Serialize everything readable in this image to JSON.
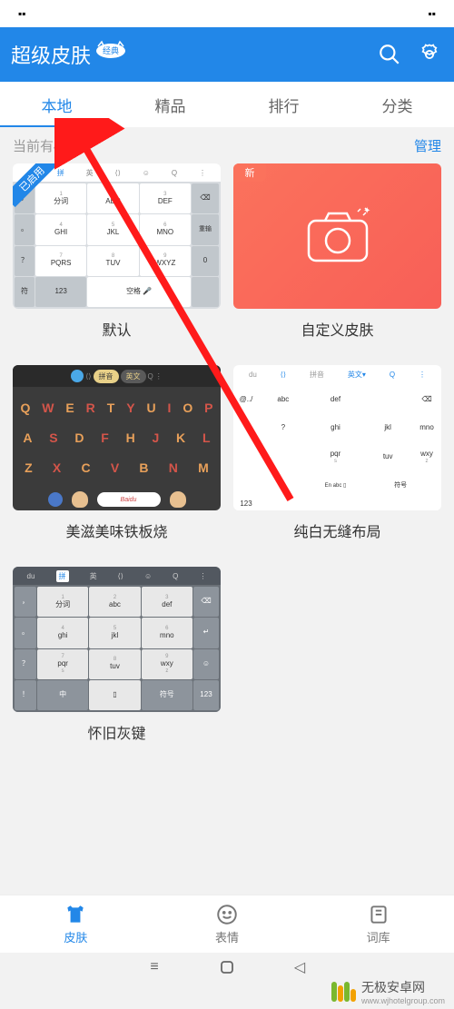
{
  "header": {
    "title": "超级皮肤",
    "badge": "经典"
  },
  "tabs": [
    {
      "label": "本地",
      "active": true
    },
    {
      "label": "精品",
      "active": false
    },
    {
      "label": "排行",
      "active": false
    },
    {
      "label": "分类",
      "active": false
    }
  ],
  "subheader": {
    "count_text": "当前有4套皮",
    "manage": "管理"
  },
  "skins": [
    {
      "name": "默认",
      "badge": "已启用",
      "badge_color": "blue",
      "type": "default-kb"
    },
    {
      "name": "自定义皮肤",
      "badge": "新",
      "badge_color": "red",
      "type": "custom"
    },
    {
      "name": "美滋美味铁板烧",
      "type": "food-kb"
    },
    {
      "name": "纯白无缝布局",
      "type": "white-kb"
    },
    {
      "name": "怀旧灰键",
      "type": "gray-kb"
    }
  ],
  "kb_default": {
    "top": [
      "du",
      "拼",
      "英",
      "⟨⟩",
      "☺",
      "Q",
      "⋮"
    ],
    "keys": [
      {
        "t": "1",
        "s": "分词"
      },
      {
        "t": "2",
        "s": "ABC"
      },
      {
        "t": "3",
        "s": "DEF"
      },
      {
        "t": "⌫",
        "dark": true,
        "span": "col"
      },
      {
        "t": "4",
        "s": "GHI"
      },
      {
        "t": "5",
        "s": "JKL"
      },
      {
        "t": "6",
        "s": "MNO"
      },
      {
        "t": "重输",
        "dark": true
      },
      {
        "t": "7",
        "s": "PQRS"
      },
      {
        "t": "8",
        "s": "TUV"
      },
      {
        "t": "9",
        "s": "WXYZ"
      },
      {
        "t": "0",
        "dark": true
      },
      {
        "t": "符",
        "dark": true
      },
      {
        "t": "123",
        "dark": true
      },
      {
        "t": "空格",
        "wide": true
      },
      {
        "t": "🎤",
        "dark": true
      }
    ],
    "side": [
      "，",
      "。",
      "？",
      "！"
    ]
  },
  "kb_white": {
    "top": [
      "du",
      "⟨⟩",
      "拼音",
      "英文",
      "Q",
      "⋮"
    ],
    "rows": [
      [
        {
          "t": "@../",
          "dark": true
        },
        {
          "t": "abc"
        },
        {
          "t": "def"
        },
        {
          "t": "⌫",
          "dark": true
        }
      ],
      [
        {
          "t": "?",
          "dark": true
        },
        {
          "t": "ghi"
        },
        {
          "t": "jkl"
        },
        {
          "t": "mno"
        }
      ],
      [
        {
          "t": "",
          "dark": true
        },
        {
          "t": "pqr",
          "s": "s"
        },
        {
          "t": "tuv"
        },
        {
          "t": "wxy",
          "s": "z"
        }
      ],
      [
        {
          "t": "~",
          "dark": true
        },
        {
          "t": "En"
        },
        {
          "t": "abc"
        },
        {
          "t": "▯"
        },
        {
          "t": "符号"
        },
        {
          "t": "123"
        }
      ]
    ]
  },
  "kb_gray": {
    "top": [
      "du",
      "拼",
      "英",
      "⟨⟩",
      "☺",
      "Q",
      "⋮"
    ],
    "rows": [
      [
        {
          "t": "，",
          "dark": true
        },
        {
          "t": "分词",
          "s": "1"
        },
        {
          "t": "abc",
          "s": "2"
        },
        {
          "t": "def",
          "s": "3"
        },
        {
          "t": "⌫",
          "dark": true
        }
      ],
      [
        {
          "t": "。",
          "dark": true
        },
        {
          "t": "ghi",
          "s": "4"
        },
        {
          "t": "jkl",
          "s": "5"
        },
        {
          "t": "mno",
          "s": "6"
        },
        {
          "t": "↵",
          "dark": true
        }
      ],
      [
        {
          "t": "？",
          "dark": true
        },
        {
          "t": "pqr",
          "s": "s"
        },
        {
          "t": "tuv",
          "s": "8"
        },
        {
          "t": "wxy",
          "s": "z"
        },
        {
          "t": "☺",
          "dark": true
        }
      ],
      [
        {
          "t": "！",
          "dark": true
        },
        {
          "t": "中",
          "dark": true
        },
        {
          "t": "▯"
        },
        {
          "t": "符号",
          "dark": true
        },
        {
          "t": "123",
          "dark": true
        }
      ]
    ]
  },
  "food_kb": {
    "pills": [
      "拼音",
      "英文"
    ],
    "rows": [
      [
        "Q",
        "W",
        "E",
        "R",
        "T",
        "Y",
        "U",
        "I",
        "O",
        "P"
      ],
      [
        "A",
        "S",
        "D",
        "F",
        "H",
        "J",
        "K",
        "L"
      ],
      [
        "Z",
        "X",
        "C",
        "V",
        "B",
        "N",
        "M"
      ]
    ],
    "space": "Baidu"
  },
  "nav": [
    {
      "label": "皮肤",
      "active": true,
      "icon": "shirt"
    },
    {
      "label": "表情",
      "active": false,
      "icon": "smile"
    },
    {
      "label": "词库",
      "active": false,
      "icon": "book"
    }
  ],
  "watermark": "无极安卓网",
  "watermark_sub": "www.wjhotelgroup.com"
}
